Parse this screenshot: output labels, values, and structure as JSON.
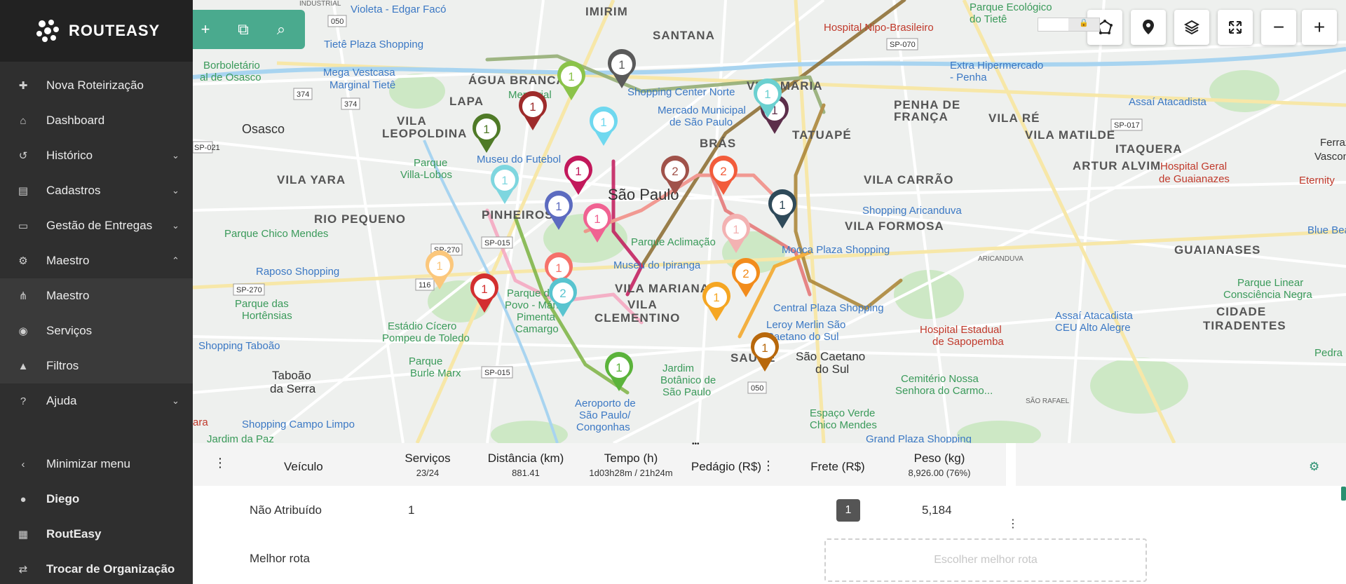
{
  "sidebar": {
    "brand": "ROUTEASY",
    "items": [
      {
        "label": "Nova Roteirização",
        "icon": "plus-icon",
        "glyph": "✚"
      },
      {
        "label": "Dashboard",
        "icon": "home-icon",
        "glyph": "⌂"
      },
      {
        "label": "Histórico",
        "icon": "history-icon",
        "glyph": "↺"
      },
      {
        "label": "Cadastros",
        "icon": "id-card-icon",
        "glyph": "▤"
      },
      {
        "label": "Gestão de Entregas",
        "icon": "monitor-icon",
        "glyph": "▭"
      },
      {
        "label": "Maestro",
        "icon": "cogs-icon",
        "glyph": "⚙"
      },
      {
        "label": "Maestro",
        "icon": "sitemap-icon",
        "glyph": "⋔"
      },
      {
        "label": "Serviços",
        "icon": "users-icon",
        "glyph": "◉"
      },
      {
        "label": "Filtros",
        "icon": "warning-icon",
        "glyph": "▲"
      },
      {
        "label": "Ajuda",
        "icon": "question-icon",
        "glyph": "?"
      },
      {
        "label": "Minimizar menu",
        "icon": "chevron-left-icon",
        "glyph": "‹"
      },
      {
        "label": "Diego",
        "icon": "user-icon",
        "glyph": "●"
      },
      {
        "label": "RoutEasy",
        "icon": "building-icon",
        "glyph": "▦"
      },
      {
        "label": "Trocar de Organização",
        "icon": "exchange-icon",
        "glyph": "⇄"
      }
    ]
  },
  "map": {
    "areas": [
      {
        "t": "IMIRIM"
      },
      {
        "t": "SANTANA"
      },
      {
        "t": "ÁGUA BRANCA"
      },
      {
        "t": "LAPA"
      },
      {
        "t": "VILA"
      },
      {
        "t": "LEOPOLDINA"
      },
      {
        "t": "Osasco"
      },
      {
        "t": "VILA YARA"
      },
      {
        "t": "RIO PEQUENO"
      },
      {
        "t": "PINHEIROS"
      },
      {
        "t": "São Paulo"
      },
      {
        "t": "BRÁS"
      },
      {
        "t": "PENHA DE"
      },
      {
        "t": "FRANÇA"
      },
      {
        "t": "VILA RÉ"
      },
      {
        "t": "VILA MATILDE"
      },
      {
        "t": "ITAQUERA"
      },
      {
        "t": "ARTUR ALVIM"
      },
      {
        "t": "VILA CARRÃO"
      },
      {
        "t": "VILA FORMOSA"
      },
      {
        "t": "GUAIANASES"
      },
      {
        "t": "CIDADE"
      },
      {
        "t": "TIRADENTES"
      },
      {
        "t": "VILA MARIANA"
      },
      {
        "t": "VILA"
      },
      {
        "t": "CLEMENTINO"
      },
      {
        "t": "Taboão"
      },
      {
        "t": "da Serra"
      },
      {
        "t": "SAÚDE"
      },
      {
        "t": "São Caetano"
      },
      {
        "t": "do Sul"
      },
      {
        "t": "VILA MARIA"
      },
      {
        "t": "TATUAPÉ"
      }
    ],
    "pois": [
      {
        "t": "Violeta - Edgar Facó"
      },
      {
        "t": "Tietê Plaza Shopping"
      },
      {
        "t": "Borboletário"
      },
      {
        "t": "al de Osasco"
      },
      {
        "t": "Mega Vestcasa"
      },
      {
        "t": "Marginal Tietê"
      },
      {
        "t": "Hospital Nipo-Brasileiro"
      },
      {
        "t": "Parque Ecológico"
      },
      {
        "t": "do Tietê"
      },
      {
        "t": "Extra Hipermercado"
      },
      {
        "t": "- Penha"
      },
      {
        "t": "Assaí Atacadista"
      },
      {
        "t": "Memorial"
      },
      {
        "t": "Shopping Center Norte"
      },
      {
        "t": "Mercado Municipal"
      },
      {
        "t": "de São Paulo"
      },
      {
        "t": "Museu do Futebol"
      },
      {
        "t": "Parque"
      },
      {
        "t": "Villa-Lobos"
      },
      {
        "t": "Parque Chico Mendes"
      },
      {
        "t": "Raposo Shopping"
      },
      {
        "t": "Parque das"
      },
      {
        "t": "Hortênsias"
      },
      {
        "t": "Estádio Cícero"
      },
      {
        "t": "Pompeu de Toledo"
      },
      {
        "t": "Shopping Taboão"
      },
      {
        "t": "Parque do"
      },
      {
        "t": "Povo - Mário"
      },
      {
        "t": "Pimenta"
      },
      {
        "t": "Camargo"
      },
      {
        "t": "Parque Aclimação"
      },
      {
        "t": "Museu do Ipiranga"
      },
      {
        "t": "Mooca Plaza Shopping"
      },
      {
        "t": "Shopping Aricanduva"
      },
      {
        "t": "Hospital Geral"
      },
      {
        "t": "de Guaianazes"
      },
      {
        "t": "Eternity"
      },
      {
        "t": "Blue Bea"
      },
      {
        "t": "Ferraz"
      },
      {
        "t": "Vascon"
      },
      {
        "t": "Parque Linear"
      },
      {
        "t": "Consciência Negra"
      },
      {
        "t": "Assaí Atacadista"
      },
      {
        "t": "CEU Alto Alegre"
      },
      {
        "t": "Central Plaza Shopping"
      },
      {
        "t": "Leroy Merlin São"
      },
      {
        "t": "Caetano do Sul"
      },
      {
        "t": "Hospital Estadual"
      },
      {
        "t": "de Sapopemba"
      },
      {
        "t": "Parque"
      },
      {
        "t": "Burle Marx"
      },
      {
        "t": "Jardim"
      },
      {
        "t": "Botânico de"
      },
      {
        "t": "São Paulo"
      },
      {
        "t": "Aeroporto de"
      },
      {
        "t": "São Paulo/"
      },
      {
        "t": "Congonhas"
      },
      {
        "t": "Cemitério Nossa"
      },
      {
        "t": "Senhora do Carmo..."
      },
      {
        "t": "Espaço Verde"
      },
      {
        "t": "Chico Mendes"
      },
      {
        "t": "Shopping Campo Limpo"
      },
      {
        "t": "Jardim da Paz"
      },
      {
        "t": "Grand Plaza Shopping"
      },
      {
        "t": "Pedra"
      },
      {
        "t": "ARICANDUVA"
      },
      {
        "t": "SÃO RAFAEL"
      },
      {
        "t": "ara"
      },
      {
        "t": "INDUSTRIAL"
      }
    ],
    "shields": [
      {
        "t": "050"
      },
      {
        "t": "374"
      },
      {
        "t": "374"
      },
      {
        "t": "SP-070"
      },
      {
        "t": "SP-017"
      },
      {
        "t": "SP-021"
      },
      {
        "t": "SP-270"
      },
      {
        "t": "SP-015"
      },
      {
        "t": "116"
      },
      {
        "t": "SP-270"
      },
      {
        "t": "SP-015"
      },
      {
        "t": "050"
      }
    ],
    "markers": [
      {
        "n": "1",
        "c": "#5a5a5a"
      },
      {
        "n": "1",
        "c": "#8bc34a"
      },
      {
        "n": "1",
        "c": "#9e2b2b"
      },
      {
        "n": "1",
        "c": "#4f7a27"
      },
      {
        "n": "1",
        "c": "#6fd8ef"
      },
      {
        "n": "1",
        "c": "#5c2e4a"
      },
      {
        "n": "1",
        "c": "#6bd0d0"
      },
      {
        "n": "1",
        "c": "#c2185b"
      },
      {
        "n": "1",
        "c": "#7ed6df"
      },
      {
        "n": "1",
        "c": "#5c6bc0"
      },
      {
        "n": "2",
        "c": "#a0524a"
      },
      {
        "n": "2",
        "c": "#f25c3b"
      },
      {
        "n": "1",
        "c": "#f06292"
      },
      {
        "n": "1",
        "c": "#2f4a5a"
      },
      {
        "n": "1",
        "c": "#f3b2b2"
      },
      {
        "n": "1",
        "c": "#fbc77c"
      },
      {
        "n": "1",
        "c": "#d32f2f"
      },
      {
        "n": "1",
        "c": "#f5716a"
      },
      {
        "n": "2",
        "c": "#58c4cf"
      },
      {
        "n": "2",
        "c": "#f28c1c"
      },
      {
        "n": "1",
        "c": "#f5a623"
      },
      {
        "n": "1",
        "c": "#b8680c"
      },
      {
        "n": "1",
        "c": "#5bb33b"
      }
    ],
    "controls": {
      "polygon": "polygon-icon",
      "pin": "map-pin-icon",
      "layers": "layers-icon",
      "fullscreen": "expand-icon",
      "zoom_out": "−",
      "zoom_in": "+"
    },
    "toolbar": {
      "add": "+",
      "copy": "⧉",
      "search": "⌕"
    }
  },
  "panel": {
    "columns": {
      "veiculo": "Veículo",
      "servicos": "Serviços",
      "servicos_sub": "23/24",
      "distancia": "Distância (km)",
      "distancia_sub": "881.41",
      "tempo": "Tempo (h)",
      "tempo_sub": "1d03h28m / 21h24m",
      "pedagio": "Pedágio (R$)",
      "frete": "Frete (R$)",
      "peso": "Peso (kg)",
      "peso_sub": "8,926.00 (76%)"
    },
    "rows": [
      {
        "label": "Não Atribuído",
        "servicos": "1",
        "peso": "5,184"
      },
      {
        "label": "Melhor rota"
      }
    ],
    "badge": "1",
    "best_route_button": "Escolher melhor rota",
    "menu_glyph": "⋮",
    "ellipsis": "•••",
    "gear": "⚙",
    "lock": "🔒"
  },
  "colors": {
    "accent": "#4aaa8e",
    "sidebar": "#2f2f2f"
  }
}
